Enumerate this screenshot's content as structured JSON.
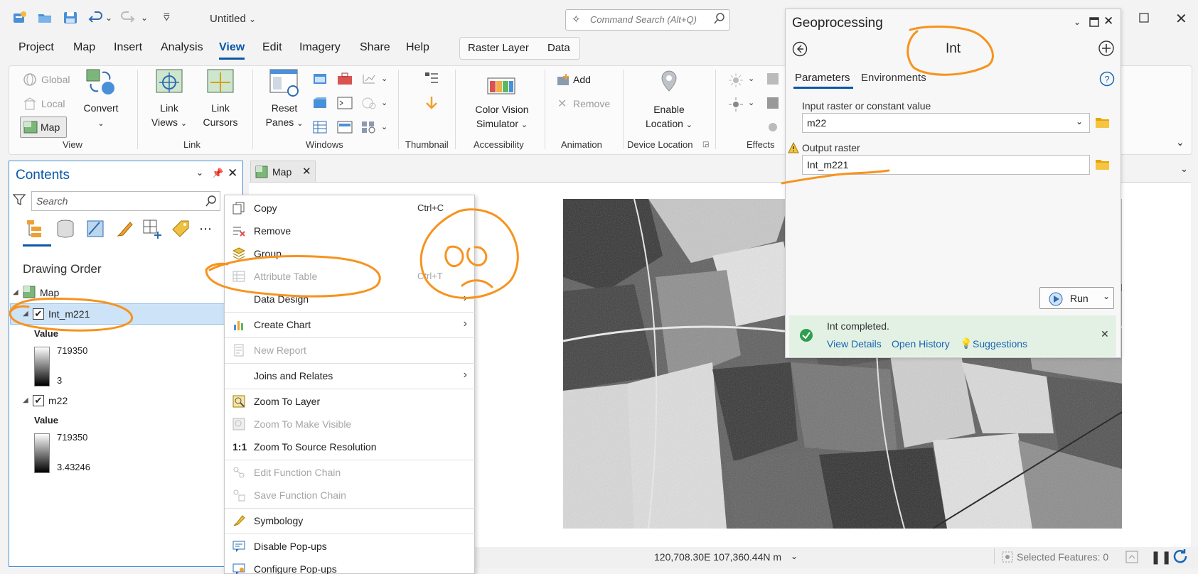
{
  "title": {
    "doc_name": "Untitled",
    "command_search_placeholder": "Command Search (Alt+Q)"
  },
  "menu": {
    "items": [
      "Project",
      "Map",
      "Insert",
      "Analysis",
      "View",
      "Edit",
      "Imagery",
      "Share",
      "Help"
    ],
    "active": "View",
    "contextual": [
      "Raster Layer",
      "Data"
    ]
  },
  "ribbon": {
    "view_group": {
      "label": "View",
      "global": "Global",
      "local": "Local",
      "map": "Map",
      "convert": "Convert"
    },
    "link_group": {
      "label": "Link",
      "link_views": [
        "Link",
        "Views"
      ],
      "link_cursors": [
        "Link",
        "Cursors"
      ]
    },
    "windows_group": {
      "label": "Windows",
      "reset_panes": [
        "Reset",
        "Panes"
      ]
    },
    "thumbnail_group": {
      "label": "Thumbnail"
    },
    "accessibility_group": {
      "label": "Accessibility",
      "cvs": [
        "Color Vision",
        "Simulator"
      ]
    },
    "animation_group": {
      "label": "Animation",
      "add": "Add",
      "remove": "Remove"
    },
    "device_group": {
      "label": "Device Location",
      "enable": [
        "Enable",
        "Location"
      ]
    },
    "effects_group": {
      "label": "Effects"
    }
  },
  "contents": {
    "title": "Contents",
    "search_placeholder": "Search",
    "drawing_order": "Drawing Order",
    "map_item": "Map",
    "layers": [
      {
        "name": "Int_m221",
        "value_label": "Value",
        "max": "719350",
        "min": "3",
        "checked": true,
        "selected": true
      },
      {
        "name": "m22",
        "value_label": "Value",
        "max": "719350",
        "min": "3.43246",
        "checked": true,
        "selected": false
      }
    ]
  },
  "map_tab": {
    "label": "Map"
  },
  "status": {
    "coords": "120,708.30E 107,360.44N m",
    "selected_features": "Selected Features: 0"
  },
  "context_menu": {
    "items": [
      {
        "label": "Copy",
        "shortcut": "Ctrl+C",
        "disabled": false,
        "icon": "copy-icon"
      },
      {
        "label": "Remove",
        "shortcut": "",
        "disabled": false,
        "icon": "remove-icon"
      },
      {
        "label": "Group",
        "shortcut": "",
        "disabled": false,
        "icon": "group-icon"
      },
      {
        "label": "Attribute Table",
        "shortcut": "Ctrl+T",
        "disabled": true,
        "icon": "table-icon"
      },
      {
        "label": "Data Design",
        "shortcut": "",
        "disabled": false,
        "submenu": true
      },
      {
        "label": "Create Chart",
        "shortcut": "",
        "disabled": false,
        "submenu": true,
        "icon": "chart-icon"
      },
      {
        "label": "New Report",
        "shortcut": "",
        "disabled": true,
        "icon": "report-icon"
      },
      {
        "label": "Joins and Relates",
        "shortcut": "",
        "disabled": false,
        "submenu": true
      },
      {
        "label": "Zoom To Layer",
        "shortcut": "",
        "disabled": false,
        "icon": "zoom-layer-icon"
      },
      {
        "label": "Zoom To Make Visible",
        "shortcut": "",
        "disabled": true,
        "icon": "zoom-visible-icon"
      },
      {
        "label": "Zoom To Source Resolution",
        "shortcut": "",
        "disabled": false,
        "icon": "one-to-one-icon"
      },
      {
        "label": "Edit Function Chain",
        "shortcut": "",
        "disabled": true,
        "icon": "function-chain-icon"
      },
      {
        "label": "Save Function Chain",
        "shortcut": "",
        "disabled": true,
        "icon": "save-chain-icon"
      },
      {
        "label": "Symbology",
        "shortcut": "",
        "disabled": false,
        "icon": "symbology-icon"
      },
      {
        "label": "Disable Pop-ups",
        "shortcut": "",
        "disabled": false,
        "icon": "popup-icon"
      },
      {
        "label": "Configure Pop-ups",
        "shortcut": "",
        "disabled": false,
        "icon": "configure-popup-icon"
      }
    ]
  },
  "geoprocessing": {
    "title": "Geoprocessing",
    "tool": "Int",
    "tabs": [
      "Parameters",
      "Environments"
    ],
    "input_label": "Input raster or constant value",
    "input_value": "m22",
    "output_label": "Output raster",
    "output_value": "Int_m221",
    "run": "Run",
    "completed": "Int completed.",
    "links": [
      "View Details",
      "Open History",
      "Suggestions"
    ]
  },
  "colors": {
    "accent": "#0a57a8",
    "annotation": "#f7931e",
    "success_bg": "#e3f1e4",
    "selected_row": "#cde3f7"
  }
}
